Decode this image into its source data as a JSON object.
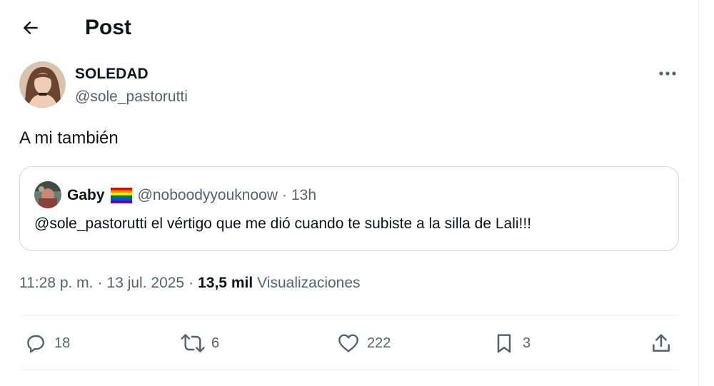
{
  "header": {
    "title": "Post",
    "back_icon": "arrow-left-icon"
  },
  "author": {
    "name": "SOLEDAD",
    "handle": "@sole_pastorutti",
    "avatar_icon": "user-avatar"
  },
  "post": {
    "text": "A mi también"
  },
  "quote": {
    "name": "Gaby",
    "flag_icon": "rainbow-flag-icon",
    "handle": "@noboodyyouknoow",
    "separator": "·",
    "time": "13h",
    "text": "@sole_pastorutti el vértigo que me dió cuando te subiste a la silla de Lali!!!"
  },
  "meta": {
    "time": "11:28 p. m.",
    "separator": "·",
    "date": "13 jul. 2025",
    "views_count": "13,5 mil",
    "views_label": "Visualizaciones"
  },
  "actions": {
    "replies": "18",
    "reposts": "6",
    "likes": "222",
    "bookmarks": "3"
  },
  "colors": {
    "text": "#0f1419",
    "secondary": "#536471",
    "border": "#cfd9de",
    "divider": "#eff3f4"
  }
}
